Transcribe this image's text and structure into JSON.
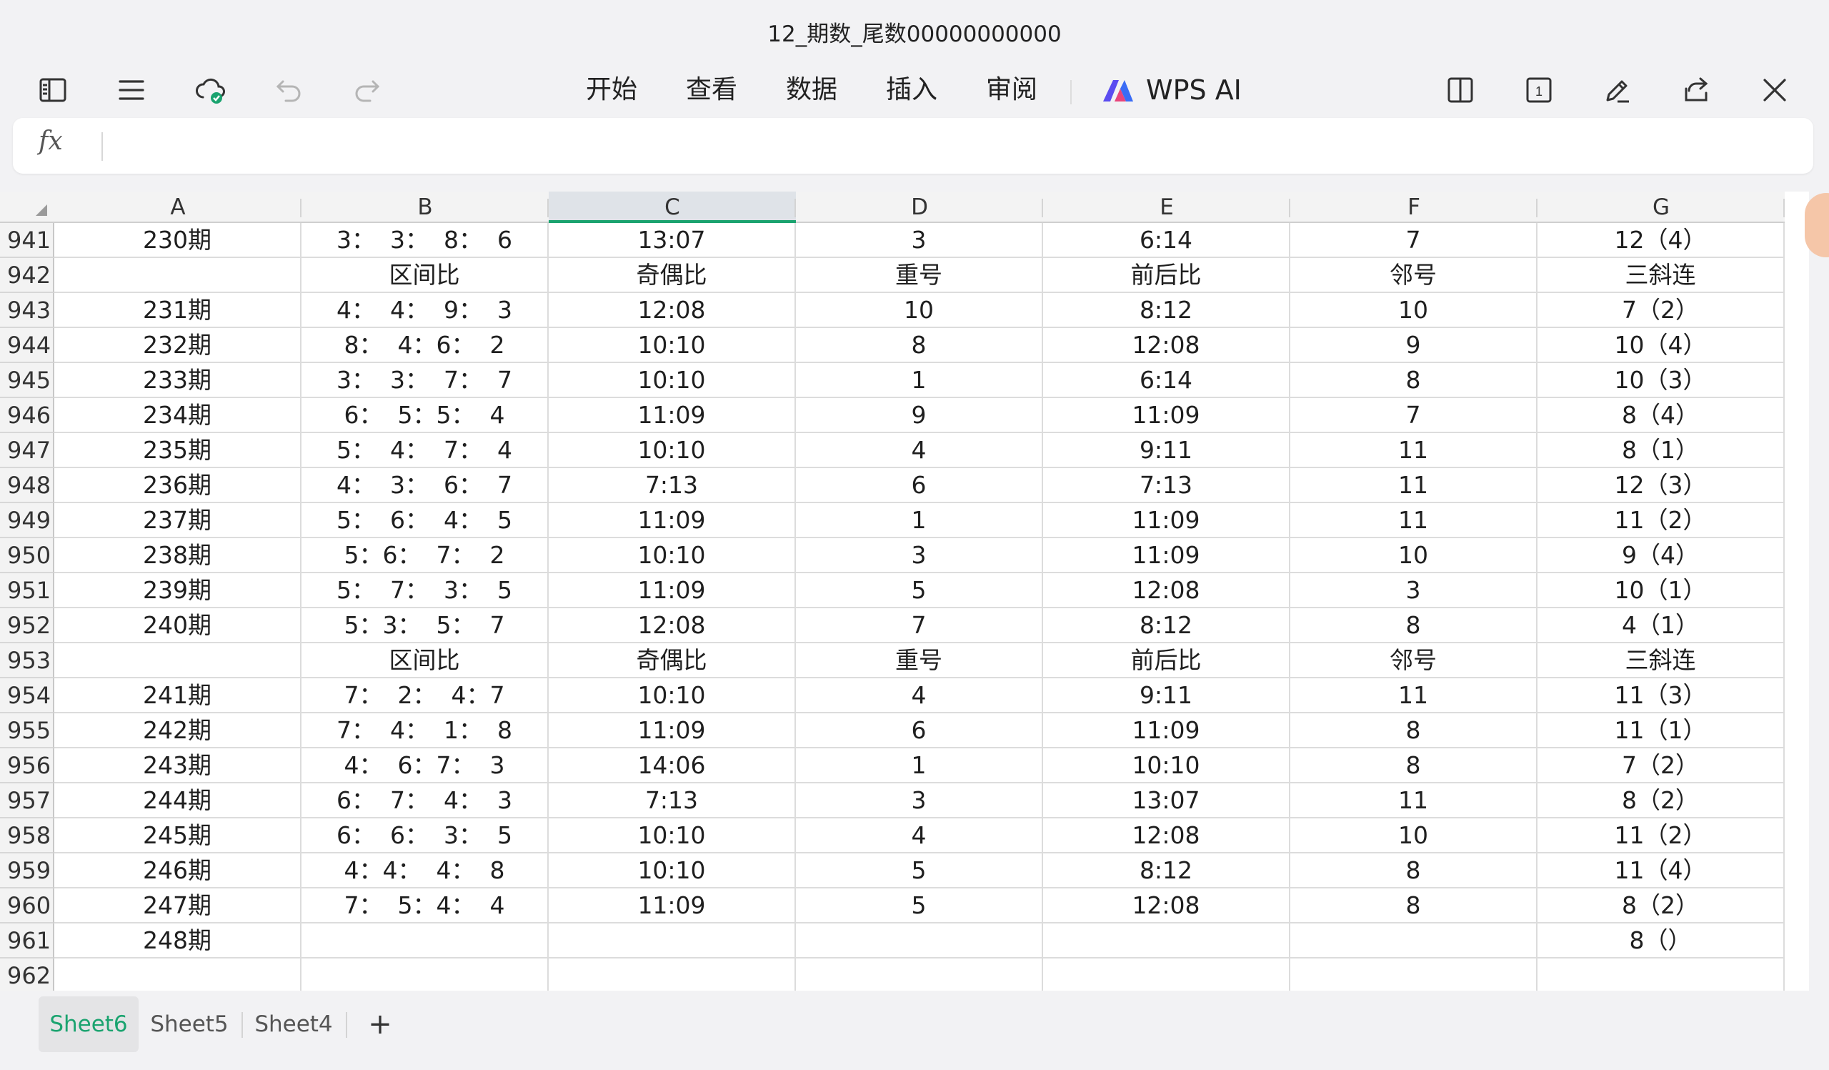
{
  "window": {
    "title": "12_期数_尾数00000000000"
  },
  "toolbar": {
    "menus": [
      "开始",
      "查看",
      "数据",
      "插入",
      "审阅"
    ],
    "ai_label": "WPS AI",
    "page_count": "1"
  },
  "formula_bar": {
    "fx_label": "fx",
    "value": ""
  },
  "columns": [
    "A",
    "B",
    "C",
    "D",
    "E",
    "F",
    "G"
  ],
  "selected_column": "C",
  "rows": [
    {
      "n": "941",
      "cells": [
        "230期",
        "3：  3：  8：  6",
        "13:07",
        "3",
        "6:14",
        "7",
        "12（4）"
      ]
    },
    {
      "n": "942",
      "cells": [
        "",
        "区间比",
        "奇偶比",
        "重号",
        "前后比",
        "邻号",
        "三斜连"
      ]
    },
    {
      "n": "943",
      "cells": [
        "231期",
        "4：  4：  9：  3",
        "12:08",
        "10",
        "8:12",
        "10",
        "7（2）"
      ]
    },
    {
      "n": "944",
      "cells": [
        "232期",
        "8：  4：6：  2",
        "10:10",
        "8",
        "12:08",
        "9",
        "10（4）"
      ]
    },
    {
      "n": "945",
      "cells": [
        "233期",
        "3：  3：  7：  7",
        "10:10",
        "1",
        "6:14",
        "8",
        "10（3）"
      ]
    },
    {
      "n": "946",
      "cells": [
        "234期",
        "6：  5：5：  4",
        "11:09",
        "9",
        "11:09",
        "7",
        "8（4）"
      ]
    },
    {
      "n": "947",
      "cells": [
        "235期",
        "5：  4：  7：  4",
        "10:10",
        "4",
        "9:11",
        "11",
        "8（1）"
      ]
    },
    {
      "n": "948",
      "cells": [
        "236期",
        "4：  3：  6：  7",
        "7:13",
        "6",
        "7:13",
        "11",
        "12（3）"
      ]
    },
    {
      "n": "949",
      "cells": [
        "237期",
        "5：  6：  4：  5",
        "11:09",
        "1",
        "11:09",
        "11",
        "11（2）"
      ]
    },
    {
      "n": "950",
      "cells": [
        "238期",
        "5：6：  7：  2",
        "10:10",
        "3",
        "11:09",
        "10",
        "9（4）"
      ]
    },
    {
      "n": "951",
      "cells": [
        "239期",
        "5：  7：  3：  5",
        "11:09",
        "5",
        "12:08",
        "3",
        "10（1）"
      ]
    },
    {
      "n": "952",
      "cells": [
        "240期",
        "5：3：  5：  7",
        "12:08",
        "7",
        "8:12",
        "8",
        "4（1）"
      ]
    },
    {
      "n": "953",
      "cells": [
        "",
        "区间比",
        "奇偶比",
        "重号",
        "前后比",
        "邻号",
        "三斜连"
      ]
    },
    {
      "n": "954",
      "cells": [
        "241期",
        "7：  2：  4：7",
        "10:10",
        "4",
        "9:11",
        "11",
        "11（3）"
      ]
    },
    {
      "n": "955",
      "cells": [
        "242期",
        "7：  4：  1：  8",
        "11:09",
        "6",
        "11:09",
        "8",
        "11（1）"
      ]
    },
    {
      "n": "956",
      "cells": [
        "243期",
        "4：  6：7：  3",
        "14:06",
        "1",
        "10:10",
        "8",
        "7（2）"
      ]
    },
    {
      "n": "957",
      "cells": [
        "244期",
        "6：  7：  4：  3",
        "7:13",
        "3",
        "13:07",
        "11",
        "8（2）"
      ]
    },
    {
      "n": "958",
      "cells": [
        "245期",
        "6：  6：  3：  5",
        "10:10",
        "4",
        "12:08",
        "10",
        "11（2）"
      ]
    },
    {
      "n": "959",
      "cells": [
        "246期",
        "4：4：  4：  8",
        "10:10",
        "5",
        "8:12",
        "8",
        "11（4）"
      ]
    },
    {
      "n": "960",
      "cells": [
        "247期",
        "7：  5：4：  4",
        "11:09",
        "5",
        "12:08",
        "8",
        "8（2）"
      ]
    },
    {
      "n": "961",
      "cells": [
        "248期",
        "",
        "",
        "",
        "",
        "",
        "8（）"
      ]
    },
    {
      "n": "962",
      "cells": [
        "",
        "",
        "",
        "",
        "",
        "",
        ""
      ]
    }
  ],
  "sheets": {
    "tabs": [
      "Sheet6",
      "Sheet5",
      "Sheet4"
    ],
    "active": "Sheet6",
    "add_label": "+"
  },
  "colors": {
    "accent": "#1aa36f",
    "header_bg": "#f3f3f3",
    "selected_header": "#dfe3e8"
  }
}
